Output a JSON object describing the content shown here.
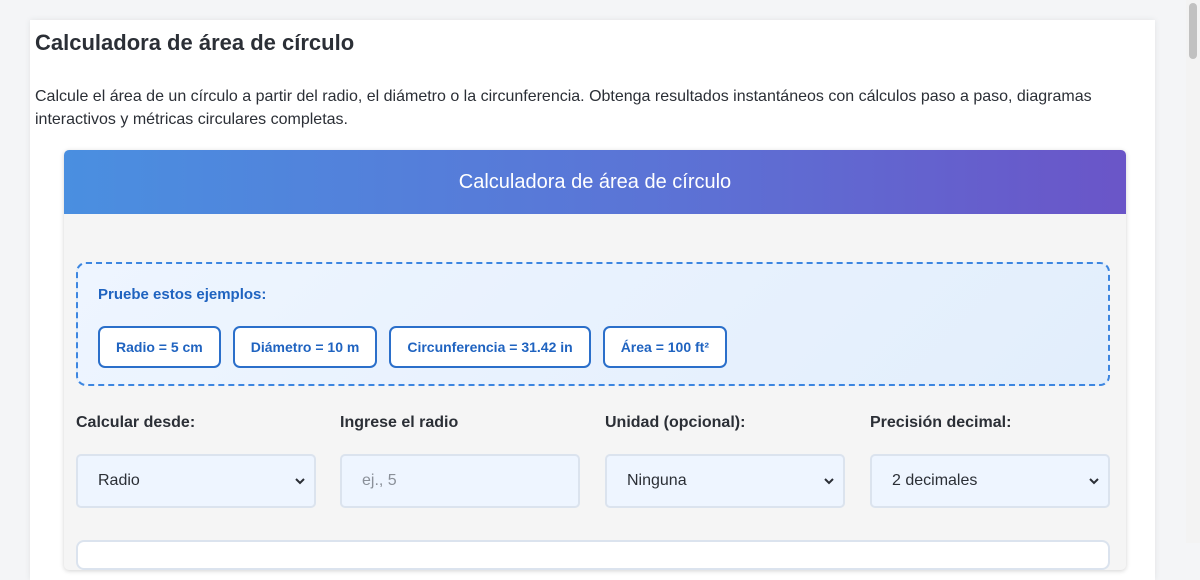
{
  "page": {
    "title": "Calculadora de área de círculo",
    "description": "Calcule el área de un círculo a partir del radio, el diámetro o la circunferencia. Obtenga resultados instantáneos con cálculos paso a paso, diagramas interactivos y métricas circulares completas."
  },
  "calculator": {
    "header": "Calculadora de área de círculo",
    "examples": {
      "title": "Pruebe estos ejemplos:",
      "buttons": [
        "Radio = 5 cm",
        "Diámetro = 10 m",
        "Circunferencia = 31.42 in",
        "Área = 100 ft²"
      ]
    },
    "fields": {
      "calc_from": {
        "label": "Calcular desde:",
        "value": "Radio"
      },
      "input": {
        "label": "Ingrese el radio",
        "placeholder": "ej., 5"
      },
      "unit": {
        "label": "Unidad (opcional):",
        "value": "Ninguna"
      },
      "precision": {
        "label": "Precisión decimal:",
        "value": "2 decimales"
      }
    }
  },
  "colors": {
    "header_gradient_start": "#4a8fe0",
    "header_gradient_end": "#6a55c8",
    "accent": "#1f63c0",
    "examples_border": "#3d86e0"
  },
  "icons": {
    "dropdown": "chevron-down-icon"
  }
}
